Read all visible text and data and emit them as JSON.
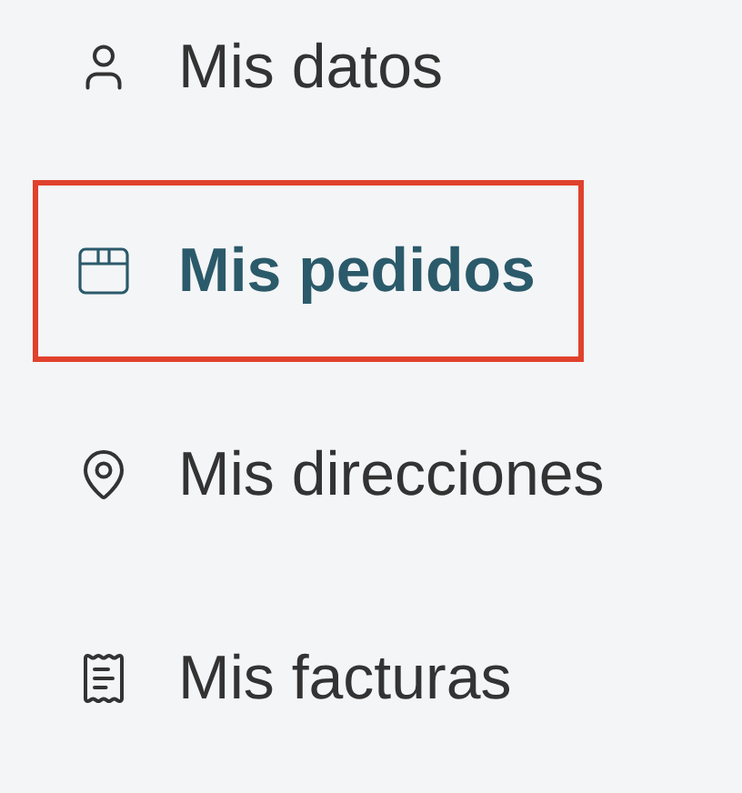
{
  "menu": {
    "items": [
      {
        "label": "Mis datos",
        "kind": "user",
        "selected": false
      },
      {
        "label": "Mis pedidos",
        "kind": "box",
        "selected": true
      },
      {
        "label": "Mis direcciones",
        "kind": "pin",
        "selected": false
      },
      {
        "label": "Mis facturas",
        "kind": "receipt",
        "selected": false
      }
    ]
  }
}
